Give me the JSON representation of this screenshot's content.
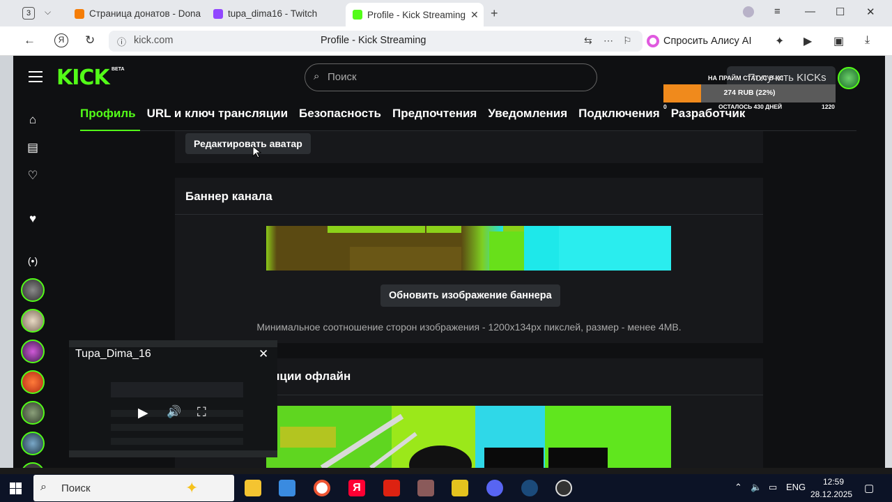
{
  "browser": {
    "tab_count": "3",
    "tabs": [
      {
        "title": "Страница донатов - Dona",
        "favicon_color": "#f57d07"
      },
      {
        "title": "tupa_dima16 - Twitch",
        "favicon_color": "#9146ff"
      },
      {
        "title": "Profile - Kick Streaming",
        "favicon_color": "#53fc18"
      }
    ],
    "url": "kick.com",
    "page_title": "Profile - Kick Streaming",
    "alisa_label": "Спросить Алису AI"
  },
  "kick": {
    "logo": "KICK",
    "beta": "BETA",
    "search_placeholder": "Поиск",
    "buy_kicks": "Получить KICKs",
    "accent": "#53fc18",
    "tabs": [
      "Профиль",
      "URL и ключ трансляции",
      "Безопасность",
      "Предпочтения",
      "Уведомления",
      "Подключения",
      "Разработчик"
    ],
    "edit_avatar": "Редактировать аватар",
    "banner_title": "Баннер канала",
    "update_banner": "Обновить изображение баннера",
    "banner_hint": "Минимальное соотношение сторон изображения - 1200x134px пикслей, размер - менее 4MB.",
    "offline_title": "Баннер трансляции офлайн"
  },
  "donation_goal": {
    "label": "НА ПРАЙМ СТАТУС В КС",
    "amount": "274 RUB (22%)",
    "progress_fraction": 0.22,
    "min": "0",
    "remaining": "ОСТАЛОСЬ 430 ДНЕЙ",
    "max": "1220"
  },
  "mini_player": {
    "title": "Tupa_Dima_16"
  },
  "taskbar": {
    "search": "Поиск",
    "lang": "ENG",
    "time": "12:59",
    "date": "28.12.2025"
  }
}
